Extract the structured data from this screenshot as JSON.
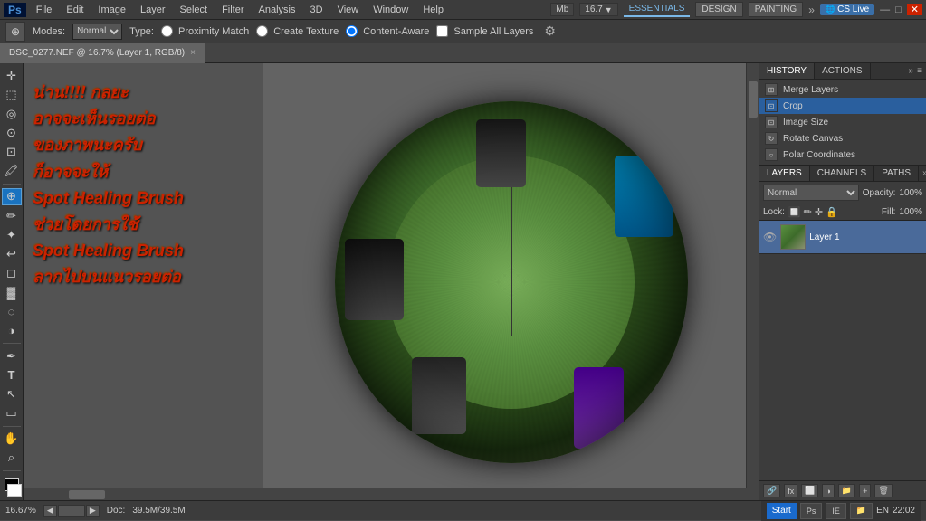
{
  "app": {
    "title": "Adobe Photoshop",
    "logo": "Ps"
  },
  "menu": {
    "items": [
      "PS",
      "File",
      "Edit",
      "Image",
      "Layer",
      "Select",
      "Filter",
      "Analysis",
      "3D",
      "View",
      "Window",
      "Help"
    ]
  },
  "topbar": {
    "mode_label": "Mb",
    "zoom_label": "16.7",
    "workspaces": [
      "ESSENTIALS",
      "DESIGN",
      "PAINTING"
    ],
    "cs_live": "CS Live"
  },
  "options_bar": {
    "modes_label": "Modes:",
    "mode_value": "Normal",
    "type_label": "Type:",
    "proximity_label": "Proximity Match",
    "texture_label": "Create Texture",
    "content_aware_label": "Content-Aware",
    "sample_label": "Sample All Layers"
  },
  "tab": {
    "name": "DSC_0277.NEF @ 16.7% (Layer 1, RGB/8)",
    "close": "×"
  },
  "annotation_texts": [
    "น่าน!!!! กลยะ",
    "อาจจะเห็นรอยต่อ",
    "ของภาพนะครับ",
    "ก็อาจจะให้",
    "Spot Healing Brush",
    "ช่วยโดยการใช้",
    "Spot Healing Brush",
    "ลากไปบนแนวรอยต่อ"
  ],
  "history": {
    "panel_tab": "HISTORY",
    "actions_tab": "ACTIONS",
    "items": [
      {
        "label": "Merge Layers",
        "icon": "⊞"
      },
      {
        "label": "Crop",
        "icon": "⊡",
        "active": true
      },
      {
        "label": "Image Size",
        "icon": "⊡"
      },
      {
        "label": "Rotate Canvas",
        "icon": "↻"
      },
      {
        "label": "Polar Coordinates",
        "icon": "○"
      }
    ]
  },
  "layers": {
    "panel_tab": "LAYERS",
    "channels_tab": "CHANNELS",
    "paths_tab": "PATHS",
    "blend_mode": "Normal",
    "opacity_label": "Opacity:",
    "opacity_value": "100%",
    "lock_label": "Lock:",
    "fill_label": "Fill:",
    "fill_value": "100%",
    "items": [
      {
        "name": "Layer 1",
        "visible": true
      }
    ]
  },
  "status_bar": {
    "zoom": "16.67%",
    "doc_label": "Doc:",
    "doc_size": "39.5M/39.5M",
    "locale": "EN",
    "time": "22:02"
  },
  "tools": {
    "left": [
      {
        "name": "move-tool",
        "icon": "✛"
      },
      {
        "name": "marquee-tool",
        "icon": "⬚"
      },
      {
        "name": "lasso-tool",
        "icon": "◎"
      },
      {
        "name": "quick-select-tool",
        "icon": "🪄"
      },
      {
        "name": "crop-tool",
        "icon": "⊡"
      },
      {
        "name": "eyedropper-tool",
        "icon": "🖍"
      },
      {
        "name": "healing-brush-tool",
        "icon": "⊕",
        "active": true
      },
      {
        "name": "brush-tool",
        "icon": "✏"
      },
      {
        "name": "clone-stamp-tool",
        "icon": "✦"
      },
      {
        "name": "history-brush-tool",
        "icon": "↩"
      },
      {
        "name": "eraser-tool",
        "icon": "◻"
      },
      {
        "name": "gradient-tool",
        "icon": "▓"
      },
      {
        "name": "blur-tool",
        "icon": "💧"
      },
      {
        "name": "dodge-tool",
        "icon": "◑"
      },
      {
        "name": "pen-tool",
        "icon": "✒"
      },
      {
        "name": "type-tool",
        "icon": "T"
      },
      {
        "name": "path-select-tool",
        "icon": "↖"
      },
      {
        "name": "shape-tool",
        "icon": "▭"
      },
      {
        "name": "hand-tool",
        "icon": "✋"
      },
      {
        "name": "zoom-tool",
        "icon": "🔍"
      }
    ]
  }
}
